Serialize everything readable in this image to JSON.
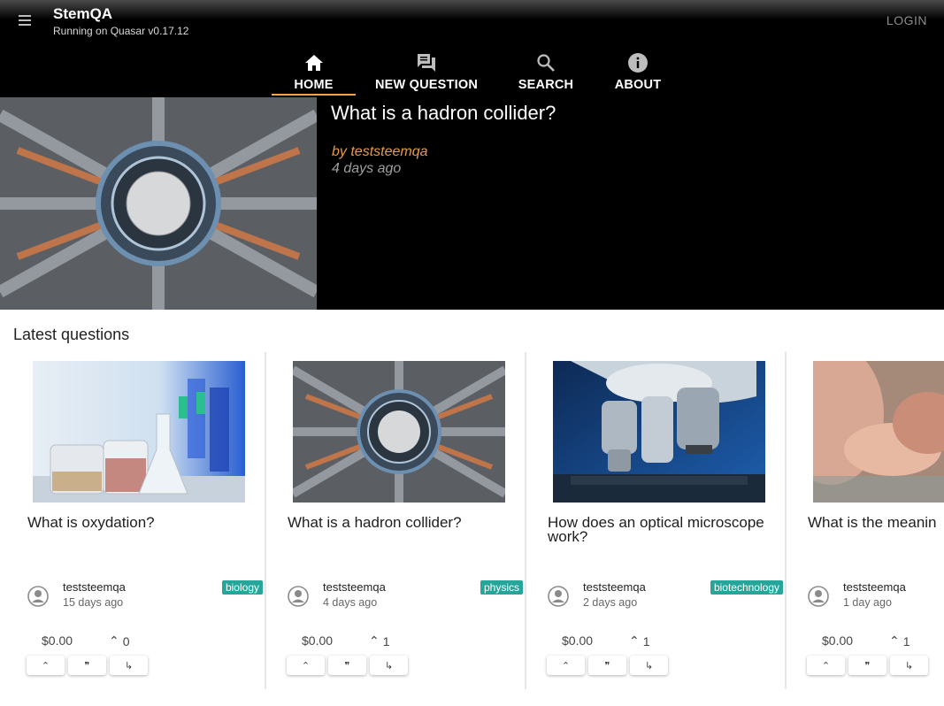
{
  "app": {
    "title": "StemQA",
    "subtitle": "Running on Quasar v0.17.12",
    "login_label": "LOGIN"
  },
  "tabs": [
    {
      "label": "HOME",
      "icon": "home-icon",
      "active": true
    },
    {
      "label": "NEW QUESTION",
      "icon": "forum-icon",
      "active": false
    },
    {
      "label": "SEARCH",
      "icon": "search-icon",
      "active": false
    },
    {
      "label": "ABOUT",
      "icon": "info-icon",
      "active": false
    }
  ],
  "colors": {
    "accent": "#f2a34a",
    "tag": "#26a69a",
    "header_bg": "#000000"
  },
  "hero": {
    "title": "What is a hadron collider?",
    "author": "by teststeemqa",
    "time": "4 days ago"
  },
  "latest": {
    "heading": "Latest questions",
    "cards": [
      {
        "title": "What is oxydation?",
        "author": "teststeemqa",
        "ago": "15 days ago",
        "tag": "biology",
        "payout": "$0.00",
        "votes": "0"
      },
      {
        "title": "What is a hadron collider?",
        "author": "teststeemqa",
        "ago": "4 days ago",
        "tag": "physics",
        "payout": "$0.00",
        "votes": "1"
      },
      {
        "title": "How does an optical microscope work?",
        "author": "teststeemqa",
        "ago": "2 days ago",
        "tag": "biotechnology",
        "payout": "$0.00",
        "votes": "1"
      },
      {
        "title": "What is the meanin",
        "author": "teststeemqa",
        "ago": "1 day ago",
        "tag": "",
        "payout": "$0.00",
        "votes": "1"
      }
    ],
    "action_icons": [
      "upvote-icon",
      "quote-icon",
      "reply-icon"
    ]
  }
}
